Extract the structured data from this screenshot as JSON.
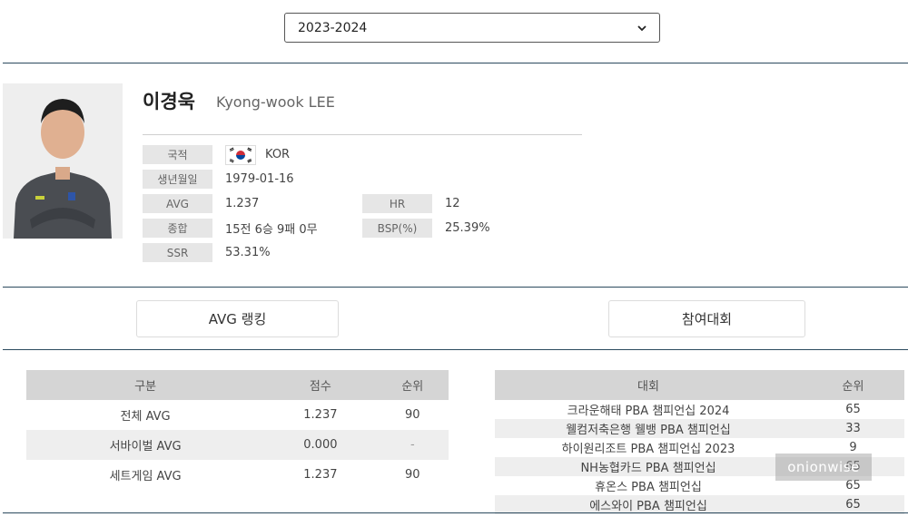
{
  "season_select": {
    "value": "2023-2024"
  },
  "player": {
    "name_ko": "이경욱",
    "name_en": "Kyong-wook LEE",
    "fields": {
      "nationality": {
        "label": "국적",
        "value": "KOR"
      },
      "birth": {
        "label": "생년월일",
        "value": "1979-01-16"
      },
      "avg": {
        "label": "AVG",
        "value": "1.237"
      },
      "hr": {
        "label": "HR",
        "value": "12"
      },
      "total": {
        "label": "종합",
        "value": "15전 6승 9패 0무"
      },
      "bsp": {
        "label": "BSP(%)",
        "value": "25.39%"
      },
      "ssr": {
        "label": "SSR",
        "value": "53.31%"
      }
    }
  },
  "tabs": {
    "avg_ranking": "AVG 랭킹",
    "tournaments": "참여대회"
  },
  "avg_table": {
    "headers": [
      "구분",
      "점수",
      "순위"
    ],
    "rows": [
      [
        "전체 AVG",
        "1.237",
        "90"
      ],
      [
        "서바이벌 AVG",
        "0.000",
        "-"
      ],
      [
        "세트게임 AVG",
        "1.237",
        "90"
      ]
    ]
  },
  "tour_table": {
    "headers": [
      "대회",
      "순위"
    ],
    "rows": [
      [
        "크라운해태 PBA 챔피언십 2024",
        "65"
      ],
      [
        "웰컴저축은행 웰뱅 PBA 챔피언십",
        "33"
      ],
      [
        "하이원리조트 PBA 챔피언십 2023",
        "9"
      ],
      [
        "NH농협카드 PBA 챔피언십",
        "65"
      ],
      [
        "휴온스 PBA 챔피언십",
        "65"
      ],
      [
        "에스와이 PBA 챔피언십",
        "65"
      ]
    ]
  },
  "watermark": "onionwise",
  "colors": {
    "divider": "#2b4a5e",
    "label_bg": "#e6e6e6",
    "header_bg": "#d5d5d5",
    "row_alt": "#eeeeee"
  }
}
